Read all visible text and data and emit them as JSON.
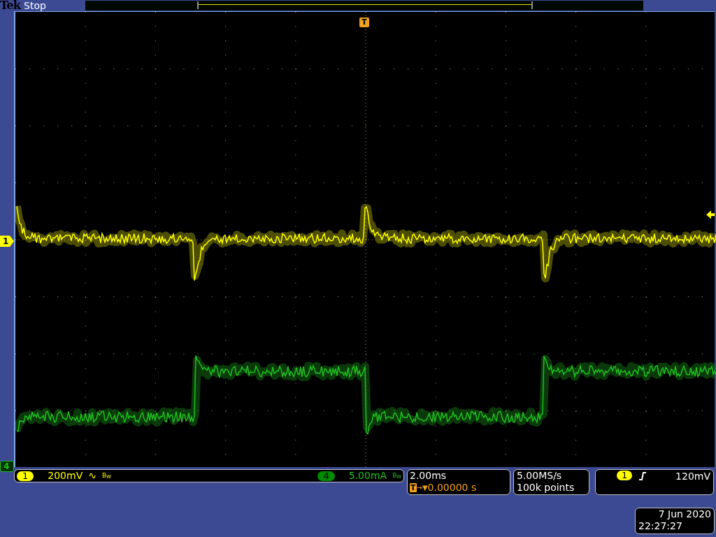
{
  "header": {
    "brand": "Tek",
    "status": "Stop"
  },
  "trigger_marker": "T",
  "channels": [
    {
      "label": "1",
      "marker": "1",
      "scale": "200mV",
      "coupling_mark": "∿",
      "bw_mark": "B$_{W}$",
      "color": "#ffff00",
      "kind": "voltage"
    },
    {
      "label": "4",
      "marker": "4",
      "scale": "5.00mA",
      "bw_mark": "B$_{W}$",
      "color": "#20c020",
      "kind": "current"
    }
  ],
  "timebase": {
    "scale": "2.00ms",
    "trigger_label": "T",
    "position_arrows": "→▼",
    "position": "0.00000 s"
  },
  "acquisition": {
    "sample_rate": "5.00MS/s",
    "record_length": "100k points"
  },
  "trigger": {
    "source": "1",
    "level": "120mV"
  },
  "datetime": {
    "date": "7 Jun 2020",
    "time": "22:27:27"
  }
}
